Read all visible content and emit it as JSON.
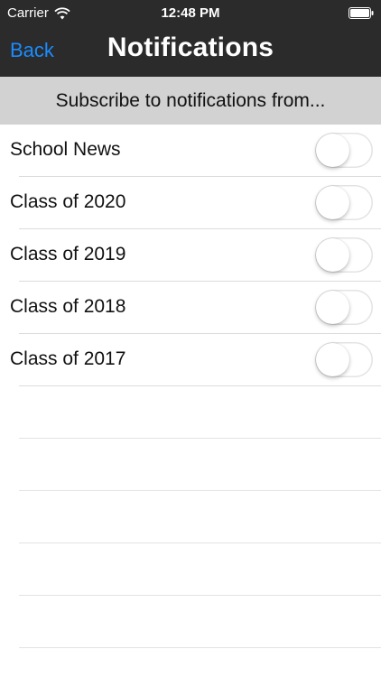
{
  "status_bar": {
    "carrier": "Carrier",
    "time": "12:48 PM",
    "wifi_icon": "wifi-icon",
    "battery_icon": "battery-icon"
  },
  "nav": {
    "back_label": "Back",
    "title": "Notifications",
    "back_color": "#1a8cff",
    "background_color": "#2b2b2b"
  },
  "section": {
    "header": "Subscribe to notifications from..."
  },
  "subscriptions": [
    {
      "label": "School News",
      "enabled": false
    },
    {
      "label": "Class of 2020",
      "enabled": false
    },
    {
      "label": "Class of 2019",
      "enabled": false
    },
    {
      "label": "Class of 2018",
      "enabled": false
    },
    {
      "label": "Class of 2017",
      "enabled": false
    }
  ]
}
